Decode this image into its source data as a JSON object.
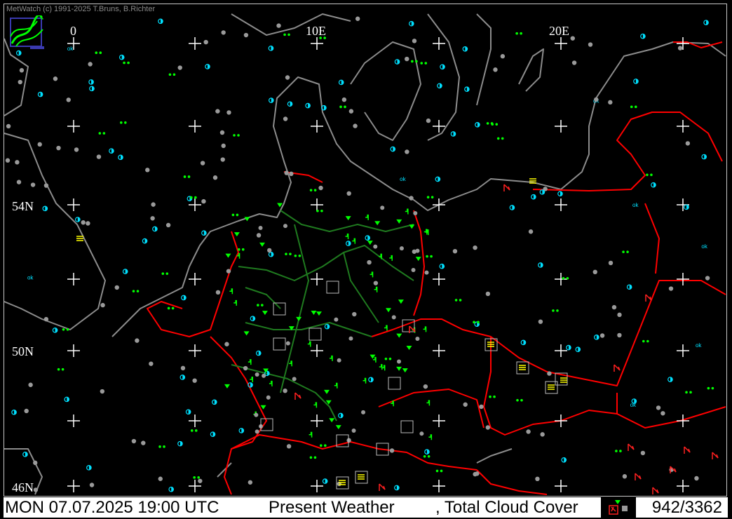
{
  "app": {
    "copyright": "MetWatch  (c) 1991-2025 T.Bruns, B.Richter"
  },
  "map": {
    "longitude_labels": [
      "0",
      "10E",
      "20E"
    ],
    "latitude_labels": [
      "54N",
      "50N",
      "46N"
    ]
  },
  "status": {
    "datetime": "MON 07.07.2025 19:00 UTC",
    "product": "Present Weather",
    "product2": ", Total Cloud Cover",
    "station_count": "942/3362"
  },
  "colors": {
    "background": "#000000",
    "coastline": "#8c8c8c",
    "national_border": "#ff0000",
    "state_border": "#1f7a1f",
    "cloud_cover_symbol": "#9a9a9a",
    "clear_sky_symbol": "#00e0ff",
    "weather_symbol": "#00ff00",
    "fog_symbol": "#ffff00",
    "thunder_symbol": "#ff2020"
  }
}
